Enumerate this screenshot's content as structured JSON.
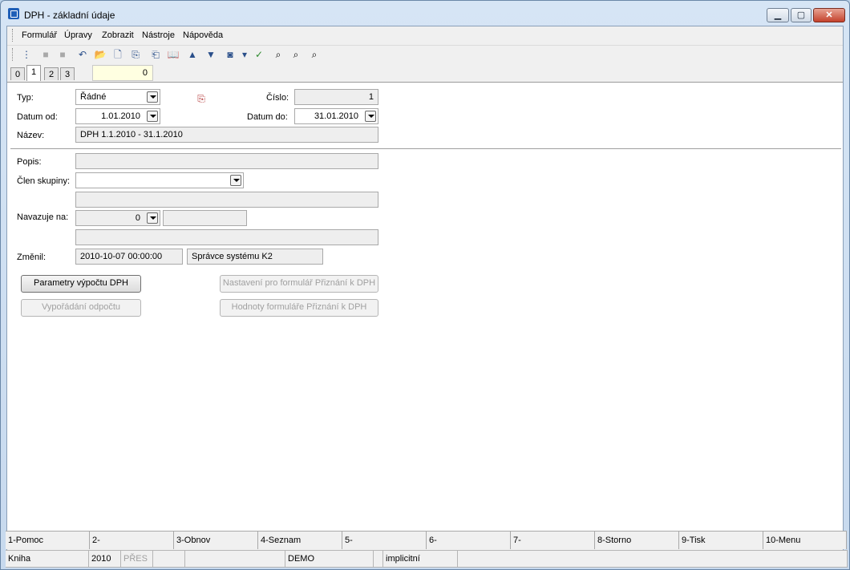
{
  "window": {
    "title": "DPH - základní údaje",
    "min_glyph": "▁",
    "max_glyph": "▢",
    "close_glyph": "✕"
  },
  "menu": [
    {
      "label": "Formulář"
    },
    {
      "label": "Úpravy"
    },
    {
      "label": "Zobrazit"
    },
    {
      "label": "Nástroje"
    },
    {
      "label": "Nápověda"
    }
  ],
  "toolbar": {
    "icons": [
      "tree-icon",
      "save-icon",
      "save-all-icon",
      "undo-icon",
      "open-folder-icon",
      "new-document-icon",
      "copy-icon",
      "paste-icon",
      "book-icon",
      "arrow-up-icon",
      "arrow-down-icon",
      "camera-icon",
      "dropdown-arrow-icon",
      "check-filter-icon",
      "binoculars-icon",
      "binoculars-next-icon",
      "binoculars-settings-icon"
    ],
    "glyphs": [
      "⋮",
      "■",
      "■",
      "↶",
      "📂",
      "🗋",
      "⎘",
      "⎗",
      "📖",
      "▲",
      "▼",
      "◙",
      "▾",
      "✓",
      "⌕",
      "⌕",
      "⌕"
    ]
  },
  "tabs": [
    {
      "label": "0"
    },
    {
      "label": "1"
    },
    {
      "label": "2"
    },
    {
      "label": "3"
    }
  ],
  "record_number": "0",
  "form": {
    "typ_label": "Typ:",
    "typ_value": "Řádné",
    "cislo_label": "Číslo:",
    "cislo_value": "1",
    "datum_od_label": "Datum od:",
    "datum_od_value": "1.01.2010",
    "datum_do_label": "Datum do:",
    "datum_do_value": "31.01.2010",
    "nazev_label": "Název:",
    "nazev_value": "DPH 1.1.2010 - 31.1.2010",
    "popis_label": "Popis:",
    "popis_value": "",
    "clen_label": "Člen skupiny:",
    "clen_value": "",
    "clen_desc": "",
    "navazuje_label": "Navazuje na:",
    "navazuje_value": "0",
    "navazuje_extra": "",
    "navazuje_desc": "",
    "zmenil_label": "Změnil:",
    "zmenil_date": "2010-10-07 00:00:00",
    "zmenil_user": "Správce systému K2"
  },
  "buttons": {
    "parametry": "Parametry výpočtu DPH",
    "nastaveni": "Nastavení pro formulář Přiznání k DPH",
    "vyporadani": "Vypořádání odpočtu",
    "hodnoty": "Hodnoty formuláře Přiznání k DPH"
  },
  "fkeys": [
    "1-Pomoc",
    "2-",
    "3-Obnov",
    "4-Seznam",
    "5-",
    "6-",
    "7-",
    "8-Storno",
    "9-Tisk",
    "10-Menu"
  ],
  "status": {
    "kniha": "Kniha",
    "blank1": "",
    "year": "2010",
    "mode": "PŘES",
    "blank2": "",
    "blank3": "",
    "db": "DEMO",
    "blank4": "",
    "profile": "implicitní",
    "blank5": ""
  }
}
